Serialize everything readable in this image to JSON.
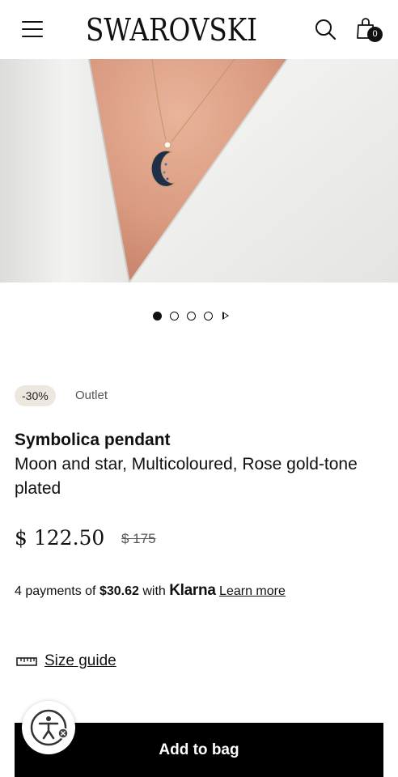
{
  "header": {
    "brand": "SWAROVSKI",
    "menu_icon": "hamburger-menu-icon",
    "search_icon": "search-icon",
    "bag_icon": "shopping-bag-icon",
    "bag_count": "0"
  },
  "hero": {
    "image_subject": "model wearing moon and star pendant necklace",
    "carousel": {
      "total_slides": 4,
      "active_index": 0,
      "play_icon": "play-icon"
    }
  },
  "product": {
    "discount_badge": "-30%",
    "category_tag": "Outlet",
    "name": "Symbolica pendant",
    "description": "Moon and star, Multicoloured, Rose gold-tone plated",
    "price": "$ 122.50",
    "original_price": "$ 175"
  },
  "payments": {
    "prefix": "4 payments of",
    "amount": "$30.62",
    "middle": "with",
    "provider": "Klarna",
    "link": "Learn more"
  },
  "size_guide": {
    "label": "Size guide",
    "icon": "ruler-icon"
  },
  "actions": {
    "add_to_bag": "Add to bag"
  },
  "accessibility": {
    "icon": "accessibility-icon"
  },
  "colors": {
    "primary": "#000000",
    "badge_bg": "#ece8df",
    "muted_text": "#555555"
  }
}
